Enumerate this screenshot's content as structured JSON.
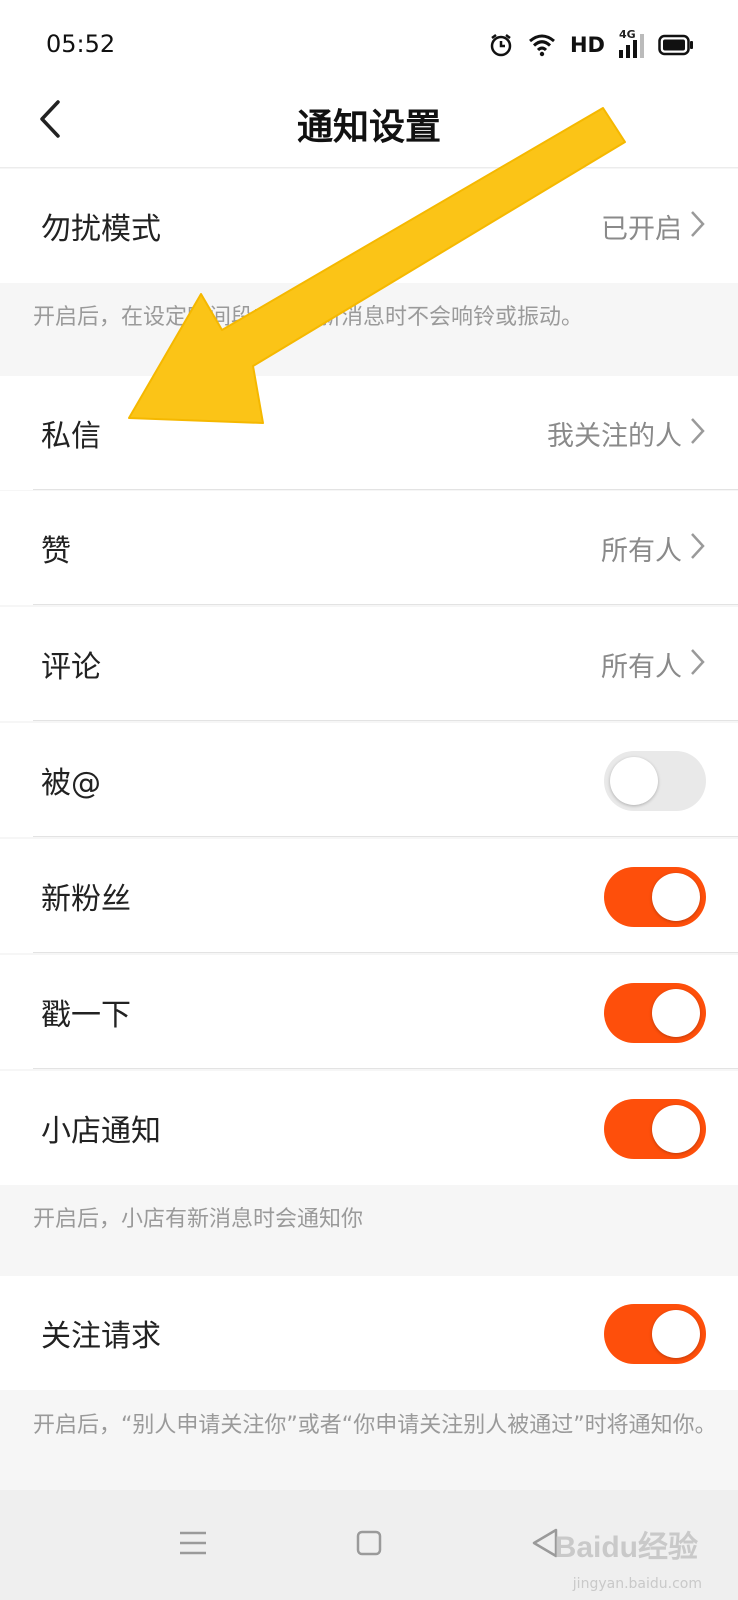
{
  "status_bar": {
    "time": "05:52",
    "icons": [
      "alarm-icon",
      "wifi-icon",
      "hd-badge",
      "signal-4g-icon",
      "battery-icon"
    ],
    "hd_label": "HD",
    "network_label": "4G"
  },
  "header": {
    "title": "通知设置",
    "back_icon": "chevron-left-icon"
  },
  "rows": {
    "dnd": {
      "label": "勿扰模式",
      "value": "已开启"
    },
    "dnd_note": "开启后，在设定时间段内收到新消息时不会响铃或振动。",
    "private_msg": {
      "label": "私信",
      "value": "我关注的人"
    },
    "likes": {
      "label": "赞",
      "value": "所有人"
    },
    "comments": {
      "label": "评论",
      "value": "所有人"
    },
    "mentions": {
      "label": "被@",
      "toggle": false
    },
    "new_fans": {
      "label": "新粉丝",
      "toggle": true
    },
    "poke": {
      "label": "戳一下",
      "toggle": true
    },
    "shop": {
      "label": "小店通知",
      "toggle": true
    },
    "shop_note": "开启后，小店有新消息时会通知你",
    "follow_request": {
      "label": "关注请求",
      "toggle": true
    },
    "follow_note": "开启后，“别人申请关注你”或者“你申请关注别人被通过”时将通知你。"
  },
  "system_nav": {
    "items": [
      "menu-icon",
      "home-square-icon",
      "back-triangle-icon"
    ]
  },
  "watermark": {
    "text": "Baidu经验",
    "sub": "jingyan.baidu.com"
  },
  "colors": {
    "accent": "#fe4f0b",
    "toggle_off": "#e9e9e9",
    "arrow": "#fbc417",
    "value_text": "#8a8a8a"
  }
}
